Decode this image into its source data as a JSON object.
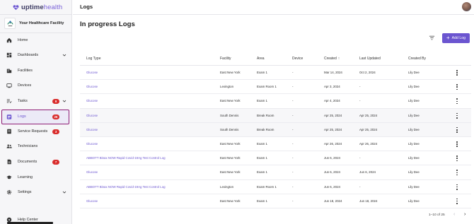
{
  "brand": {
    "name_bold": "uptime",
    "name_light": "health",
    "accent": "#6b55d0",
    "highlight": "#8d1b74"
  },
  "facility": {
    "name": "Your Healthcare Facility"
  },
  "sidebar": {
    "items": [
      {
        "label": "Home",
        "icon": "home-icon"
      },
      {
        "label": "Dashboards",
        "icon": "dashboard-icon"
      },
      {
        "label": "Facilities",
        "icon": "building-icon"
      },
      {
        "label": "Devices",
        "icon": "device-icon"
      },
      {
        "label": "Tasks",
        "icon": "tasks-icon",
        "badge": "9"
      },
      {
        "label": "Logs",
        "icon": "logs-icon",
        "badge": "26"
      },
      {
        "label": "Service Requests",
        "icon": "service-icon",
        "badge": "3"
      },
      {
        "label": "Technicians",
        "icon": "people-icon"
      },
      {
        "label": "Documents",
        "icon": "documents-icon",
        "badge": "7"
      },
      {
        "label": "Learning",
        "icon": "graduation-icon"
      },
      {
        "label": "Settings",
        "icon": "gear-icon"
      },
      {
        "label": "Help Center",
        "icon": "help-icon"
      }
    ]
  },
  "header": {
    "breadcrumb": "Logs"
  },
  "page": {
    "title": "In progress Logs",
    "add_label": "Add Log"
  },
  "table": {
    "columns": [
      "Log Type",
      "Facility",
      "Area",
      "Device",
      "Created",
      "Last Updated",
      "Created By"
    ],
    "sort_indicator": "↑",
    "rows": [
      [
        "Glucose",
        "East New York",
        "Exam 1",
        "-",
        "Mar 14, 2024",
        "Oct 2, 2024",
        "Lily Dee"
      ],
      [
        "Glucose",
        "Lexington",
        "Exam Room 1",
        "-",
        "Apr 3, 2024",
        "-",
        "Lily Dee"
      ],
      [
        "Glucose",
        "East New York",
        "Exam 1",
        "-",
        "Apr 4, 2024",
        "-",
        "Lily Dee"
      ],
      [
        "Glucose",
        "South Dennis",
        "Break Room",
        "-",
        "Apr 25, 2024",
        "Apr 25, 2024",
        "Lily Dee"
      ],
      [
        "Glucose",
        "South Dennis",
        "Break Room",
        "-",
        "Apr 25, 2024",
        "Apr 25, 2024",
        "Lily Dee"
      ],
      [
        "Glucose",
        "East New York",
        "Exam 1",
        "-",
        "Apr 26, 2024",
        "Apr 26, 2024",
        "Lily Dee"
      ],
      [
        "ABBOTT Binax NOW Rapid Covid-19Ag Test Control Log",
        "East New York",
        "Exam 1",
        "-",
        "Jun 6, 2024",
        "-",
        "Lily Dee"
      ],
      [
        "Glucose",
        "East New York",
        "Exam 1",
        "-",
        "Jun 6, 2024",
        "Jun 6, 2024",
        "Lily Dee"
      ],
      [
        "ABBOTT Binax NOW Rapid Covid-19Ag Test Control Log",
        "Lexington",
        "Exam Room 1",
        "-",
        "Jun 6, 2024",
        "-",
        "Lily Dee"
      ],
      [
        "Glucose",
        "East New York",
        "Exam 1",
        "-",
        "Jun 18, 2024",
        "Jun 18, 2024",
        "Lily Dee"
      ]
    ]
  },
  "pagination": {
    "text": "1–10 of 25",
    "prev": "‹",
    "next": "›"
  }
}
